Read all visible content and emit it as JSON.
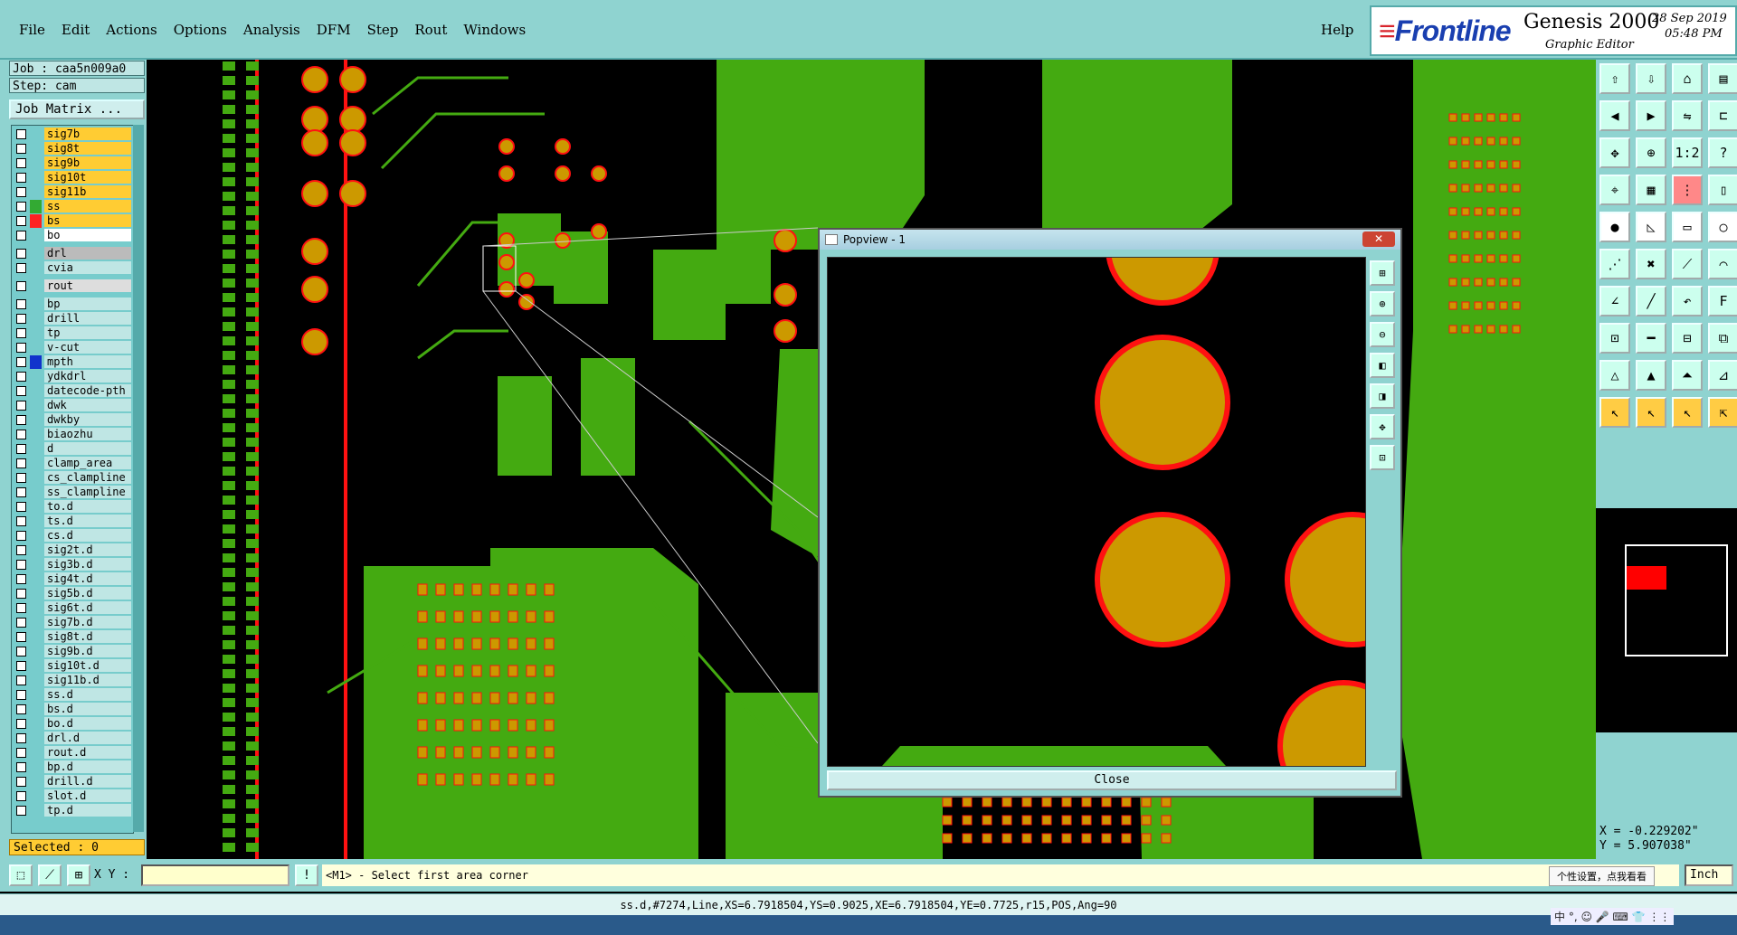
{
  "menubar": {
    "menus": [
      {
        "label": "File"
      },
      {
        "label": "Edit"
      },
      {
        "label": "Actions"
      },
      {
        "label": "Options"
      },
      {
        "label": "Analysis"
      },
      {
        "label": "DFM"
      },
      {
        "label": "Step"
      },
      {
        "label": "Rout"
      },
      {
        "label": "Windows"
      }
    ],
    "help": "Help"
  },
  "brand": {
    "logo": "Frontline",
    "title": "Genesis 2000",
    "subtitle": "Graphic Editor",
    "date": "28 Sep 2019",
    "time": "05:48 PM"
  },
  "job": {
    "job_label": "Job : caa5n009a0",
    "step_label": "Step: cam",
    "job_matrix": "Job Matrix ..."
  },
  "layers": [
    {
      "name": "sig7b",
      "bg": "#ffcc33",
      "swatch": ""
    },
    {
      "name": "sig8t",
      "bg": "#ffcc33",
      "swatch": ""
    },
    {
      "name": "sig9b",
      "bg": "#ffcc33",
      "swatch": ""
    },
    {
      "name": "sig10t",
      "bg": "#ffcc33",
      "swatch": ""
    },
    {
      "name": "sig11b",
      "bg": "#ffcc33",
      "swatch": ""
    },
    {
      "name": "ss",
      "bg": "#ffcc33",
      "swatch": "#33aa33"
    },
    {
      "name": "bs",
      "bg": "#ffcc33",
      "swatch": "#ff2222"
    },
    {
      "name": "bo",
      "bg": "#ffffff",
      "swatch": ""
    },
    {
      "name": "drl",
      "bg": "#bbbbbb",
      "swatch": ""
    },
    {
      "name": "cvia",
      "bg": "#bfe6e4",
      "swatch": ""
    },
    {
      "name": "rout",
      "bg": "#dddddd",
      "swatch": ""
    },
    {
      "name": "bp",
      "bg": "#bfe6e4",
      "swatch": ""
    },
    {
      "name": "drill",
      "bg": "#bfe6e4",
      "swatch": ""
    },
    {
      "name": "tp",
      "bg": "#bfe6e4",
      "swatch": ""
    },
    {
      "name": "v-cut",
      "bg": "#bfe6e4",
      "swatch": ""
    },
    {
      "name": "mpth",
      "bg": "#bfe6e4",
      "swatch": "#1133cc"
    },
    {
      "name": "ydkdrl",
      "bg": "#bfe6e4",
      "swatch": ""
    },
    {
      "name": "datecode-pth",
      "bg": "#bfe6e4",
      "swatch": ""
    },
    {
      "name": "dwk",
      "bg": "#bfe6e4",
      "swatch": ""
    },
    {
      "name": "dwkby",
      "bg": "#bfe6e4",
      "swatch": ""
    },
    {
      "name": "biaozhu",
      "bg": "#bfe6e4",
      "swatch": ""
    },
    {
      "name": "d",
      "bg": "#bfe6e4",
      "swatch": ""
    },
    {
      "name": "clamp_area",
      "bg": "#bfe6e4",
      "swatch": ""
    },
    {
      "name": "cs_clampline",
      "bg": "#bfe6e4",
      "swatch": ""
    },
    {
      "name": "ss_clampline",
      "bg": "#bfe6e4",
      "swatch": ""
    },
    {
      "name": "to.d",
      "bg": "#bfe6e4",
      "swatch": ""
    },
    {
      "name": "ts.d",
      "bg": "#bfe6e4",
      "swatch": ""
    },
    {
      "name": "cs.d",
      "bg": "#bfe6e4",
      "swatch": ""
    },
    {
      "name": "sig2t.d",
      "bg": "#bfe6e4",
      "swatch": ""
    },
    {
      "name": "sig3b.d",
      "bg": "#bfe6e4",
      "swatch": ""
    },
    {
      "name": "sig4t.d",
      "bg": "#bfe6e4",
      "swatch": ""
    },
    {
      "name": "sig5b.d",
      "bg": "#bfe6e4",
      "swatch": ""
    },
    {
      "name": "sig6t.d",
      "bg": "#bfe6e4",
      "swatch": ""
    },
    {
      "name": "sig7b.d",
      "bg": "#bfe6e4",
      "swatch": ""
    },
    {
      "name": "sig8t.d",
      "bg": "#bfe6e4",
      "swatch": ""
    },
    {
      "name": "sig9b.d",
      "bg": "#bfe6e4",
      "swatch": ""
    },
    {
      "name": "sig10t.d",
      "bg": "#bfe6e4",
      "swatch": ""
    },
    {
      "name": "sig11b.d",
      "bg": "#bfe6e4",
      "swatch": ""
    },
    {
      "name": "ss.d",
      "bg": "#bfe6e4",
      "swatch": ""
    },
    {
      "name": "bs.d",
      "bg": "#bfe6e4",
      "swatch": ""
    },
    {
      "name": "bo.d",
      "bg": "#bfe6e4",
      "swatch": ""
    },
    {
      "name": "drl.d",
      "bg": "#bfe6e4",
      "swatch": ""
    },
    {
      "name": "rout.d",
      "bg": "#bfe6e4",
      "swatch": ""
    },
    {
      "name": "bp.d",
      "bg": "#bfe6e4",
      "swatch": ""
    },
    {
      "name": "drill.d",
      "bg": "#bfe6e4",
      "swatch": ""
    },
    {
      "name": "slot.d",
      "bg": "#bfe6e4",
      "swatch": ""
    },
    {
      "name": "tp.d",
      "bg": "#bfe6e4",
      "swatch": ""
    }
  ],
  "selected": "Selected : 0",
  "popview": {
    "title": "Popview - 1",
    "close_label": "Close"
  },
  "coords": {
    "x": "X = -0.229202\"",
    "y": "Y = 5.907038\""
  },
  "cmd": {
    "xy_label": "X Y :",
    "prompt": "<M1> - Select first area corner",
    "tooltip": "个性设置，点我看看",
    "unit": "Inch"
  },
  "info": "ss.d,#7274,Line,XS=6.7918504,YS=0.9025,XE=6.7918504,YE=0.7725,r15,POS,Ang=90",
  "ime": "中 °, ☺ 🎤 ⌨ 👕 ⋮⋮",
  "colors": {
    "copper": "#44aa11",
    "pad": "#cc9900",
    "mask": "#ff1111",
    "panel": "#8fd3d0"
  }
}
